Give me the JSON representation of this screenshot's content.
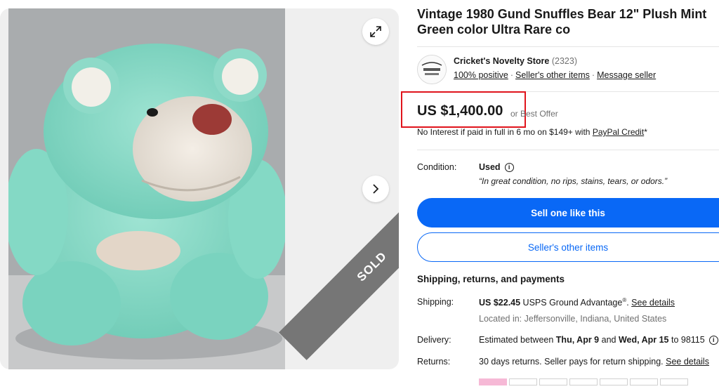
{
  "gallery": {
    "expand_icon": "expand-arrows-icon",
    "next_icon": "chevron-right-icon",
    "sold_label": "SOLD"
  },
  "listing": {
    "title": "Vintage 1980 Gund Snuffles Bear 12\" Plush Mint Green color Ultra Rare co"
  },
  "seller": {
    "name": "Cricket's Novelty Store",
    "feedback_count": "(2323)",
    "positive": "100% positive",
    "other_items_link": "Seller's other items",
    "message_link": "Message seller"
  },
  "price": {
    "amount": "US $1,400.00",
    "best_offer": "or Best Offer",
    "financing_text": "No Interest if paid in full in 6 mo on $149+ with ",
    "financing_link": "PayPal Credit",
    "financing_suffix": "*"
  },
  "condition": {
    "label": "Condition:",
    "value": "Used",
    "description": "“In great condition, no rips, stains, tears, or odors.”"
  },
  "actions": {
    "sell_one": "Sell one like this",
    "sellers_other_items": "Seller's other items"
  },
  "shipping_section": {
    "title": "Shipping, returns, and payments",
    "shipping_label": "Shipping:",
    "shipping_price": "US $22.45",
    "shipping_service": " USPS Ground Advantage",
    "shipping_reg": "®",
    "see_details": "See details",
    "location": "Located in: Jeffersonville, Indiana, United States",
    "delivery_label": "Delivery:",
    "delivery_prefix": "Estimated between ",
    "delivery_start": "Thu, Apr 9",
    "delivery_and": " and ",
    "delivery_end": "Wed, Apr 15",
    "delivery_zip": " to 98115",
    "returns_label": "Returns:",
    "returns_text": "30 days returns. Seller pays for return shipping. ",
    "returns_link": "See details"
  },
  "colors": {
    "primary_blue": "#0968f6",
    "highlight_red": "#e0141c",
    "sold_gray": "#767676"
  }
}
